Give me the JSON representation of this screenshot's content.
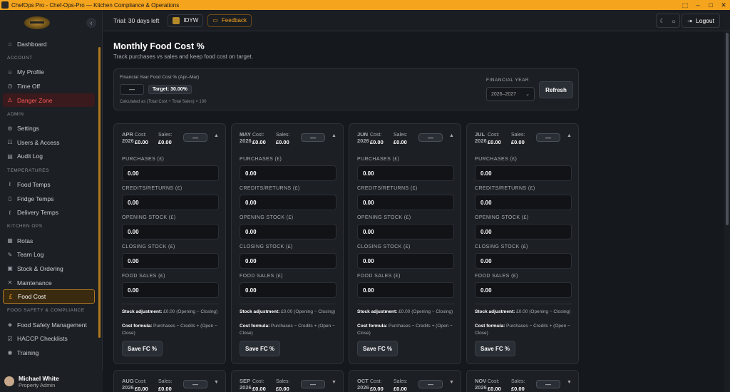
{
  "window": {
    "title": "ChefOps Pro - Chef-Ops-Pro — Kitchen Compliance & Operations"
  },
  "sidebar": {
    "collapse_icon": "chevron-left",
    "top": [
      {
        "label": "Dashboard",
        "icon": "home-icon"
      }
    ],
    "sections": [
      {
        "title": "ACCOUNT",
        "items": [
          {
            "label": "My Profile"
          },
          {
            "label": "Time Off"
          },
          {
            "label": "Danger Zone",
            "state": "danger"
          }
        ]
      },
      {
        "title": "ADMIN",
        "items": [
          {
            "label": "Settings"
          },
          {
            "label": "Users & Access"
          },
          {
            "label": "Audit Log"
          }
        ]
      },
      {
        "title": "TEMPERATURES",
        "items": [
          {
            "label": "Food Temps"
          },
          {
            "label": "Fridge Temps"
          },
          {
            "label": "Delivery Temps"
          }
        ]
      },
      {
        "title": "KITCHEN OPS",
        "items": [
          {
            "label": "Rotas"
          },
          {
            "label": "Team Log"
          },
          {
            "label": "Stock & Ordering"
          },
          {
            "label": "Maintenance"
          },
          {
            "label": "Food Cost",
            "state": "active"
          }
        ]
      },
      {
        "title": "FOOD SAFETY & COMPLIANCE",
        "items": [
          {
            "label": "Food Safety Management"
          },
          {
            "label": "HACCP Checklists"
          },
          {
            "label": "Training"
          }
        ]
      }
    ],
    "user": {
      "name": "Michael White",
      "role": "Property Admin"
    }
  },
  "topbar": {
    "trial": "Trial: 30 days left",
    "site": "IDYW",
    "feedback": "Feedback",
    "logout": "Logout"
  },
  "page": {
    "title": "Monthly Food Cost %",
    "subtitle": "Track purchases vs sales and keep food cost on target."
  },
  "fy_panel": {
    "label": "Financial Year Food Cost % (Apr–Mar)",
    "value": "—",
    "target": "Target: 30.00%",
    "note": "Calculated as (Total Cost ÷ Total Sales) × 100",
    "fy_label": "FINANCIAL YEAR",
    "fy_value": "2026–2027",
    "refresh": "Refresh"
  },
  "labels": {
    "cost": "Cost:",
    "sales": "Sales:",
    "purchases": "PURCHASES (£)",
    "credits": "CREDITS/RETURNS (£)",
    "opening": "OPENING STOCK (£)",
    "closing": "CLOSING STOCK (£)",
    "food_sales": "FOOD SALES (£)",
    "stock_adj_label": "Stock adjustment:",
    "stock_adj_text": " £0.00 (Opening − Closing)",
    "formula_label": "Cost formula:",
    "formula_text": " Purchases − Credits + (Open − Close)",
    "save": "Save FC %"
  },
  "months": [
    {
      "m": "APR",
      "y": "2026",
      "cost": "£0.00",
      "sales": "£0.00",
      "fc": "—",
      "purchases": "0.00",
      "credits": "0.00",
      "opening": "0.00",
      "closing": "0.00",
      "food_sales": "0.00"
    },
    {
      "m": "MAY",
      "y": "2026",
      "cost": "£0.00",
      "sales": "£0.00",
      "fc": "—",
      "purchases": "0.00",
      "credits": "0.00",
      "opening": "0.00",
      "closing": "0.00",
      "food_sales": "0.00"
    },
    {
      "m": "JUN",
      "y": "2026",
      "cost": "£0.00",
      "sales": "£0.00",
      "fc": "—",
      "purchases": "0.00",
      "credits": "0.00",
      "opening": "0.00",
      "closing": "0.00",
      "food_sales": "0.00"
    },
    {
      "m": "JUL",
      "y": "2026",
      "cost": "£0.00",
      "sales": "£0.00",
      "fc": "—",
      "purchases": "0.00",
      "credits": "0.00",
      "opening": "0.00",
      "closing": "0.00",
      "food_sales": "0.00"
    },
    {
      "m": "AUG",
      "y": "2026",
      "cost": "£0.00",
      "sales": "£0.00",
      "fc": "—"
    },
    {
      "m": "SEP",
      "y": "2026",
      "cost": "£0.00",
      "sales": "£0.00",
      "fc": "—"
    },
    {
      "m": "OCT",
      "y": "2026",
      "cost": "£0.00",
      "sales": "£0.00",
      "fc": "—"
    },
    {
      "m": "NOV",
      "y": "2026",
      "cost": "£0.00",
      "sales": "£0.00",
      "fc": "—"
    }
  ],
  "colors": {
    "accent": "#f4a41d",
    "danger": "#ff5a5a"
  }
}
